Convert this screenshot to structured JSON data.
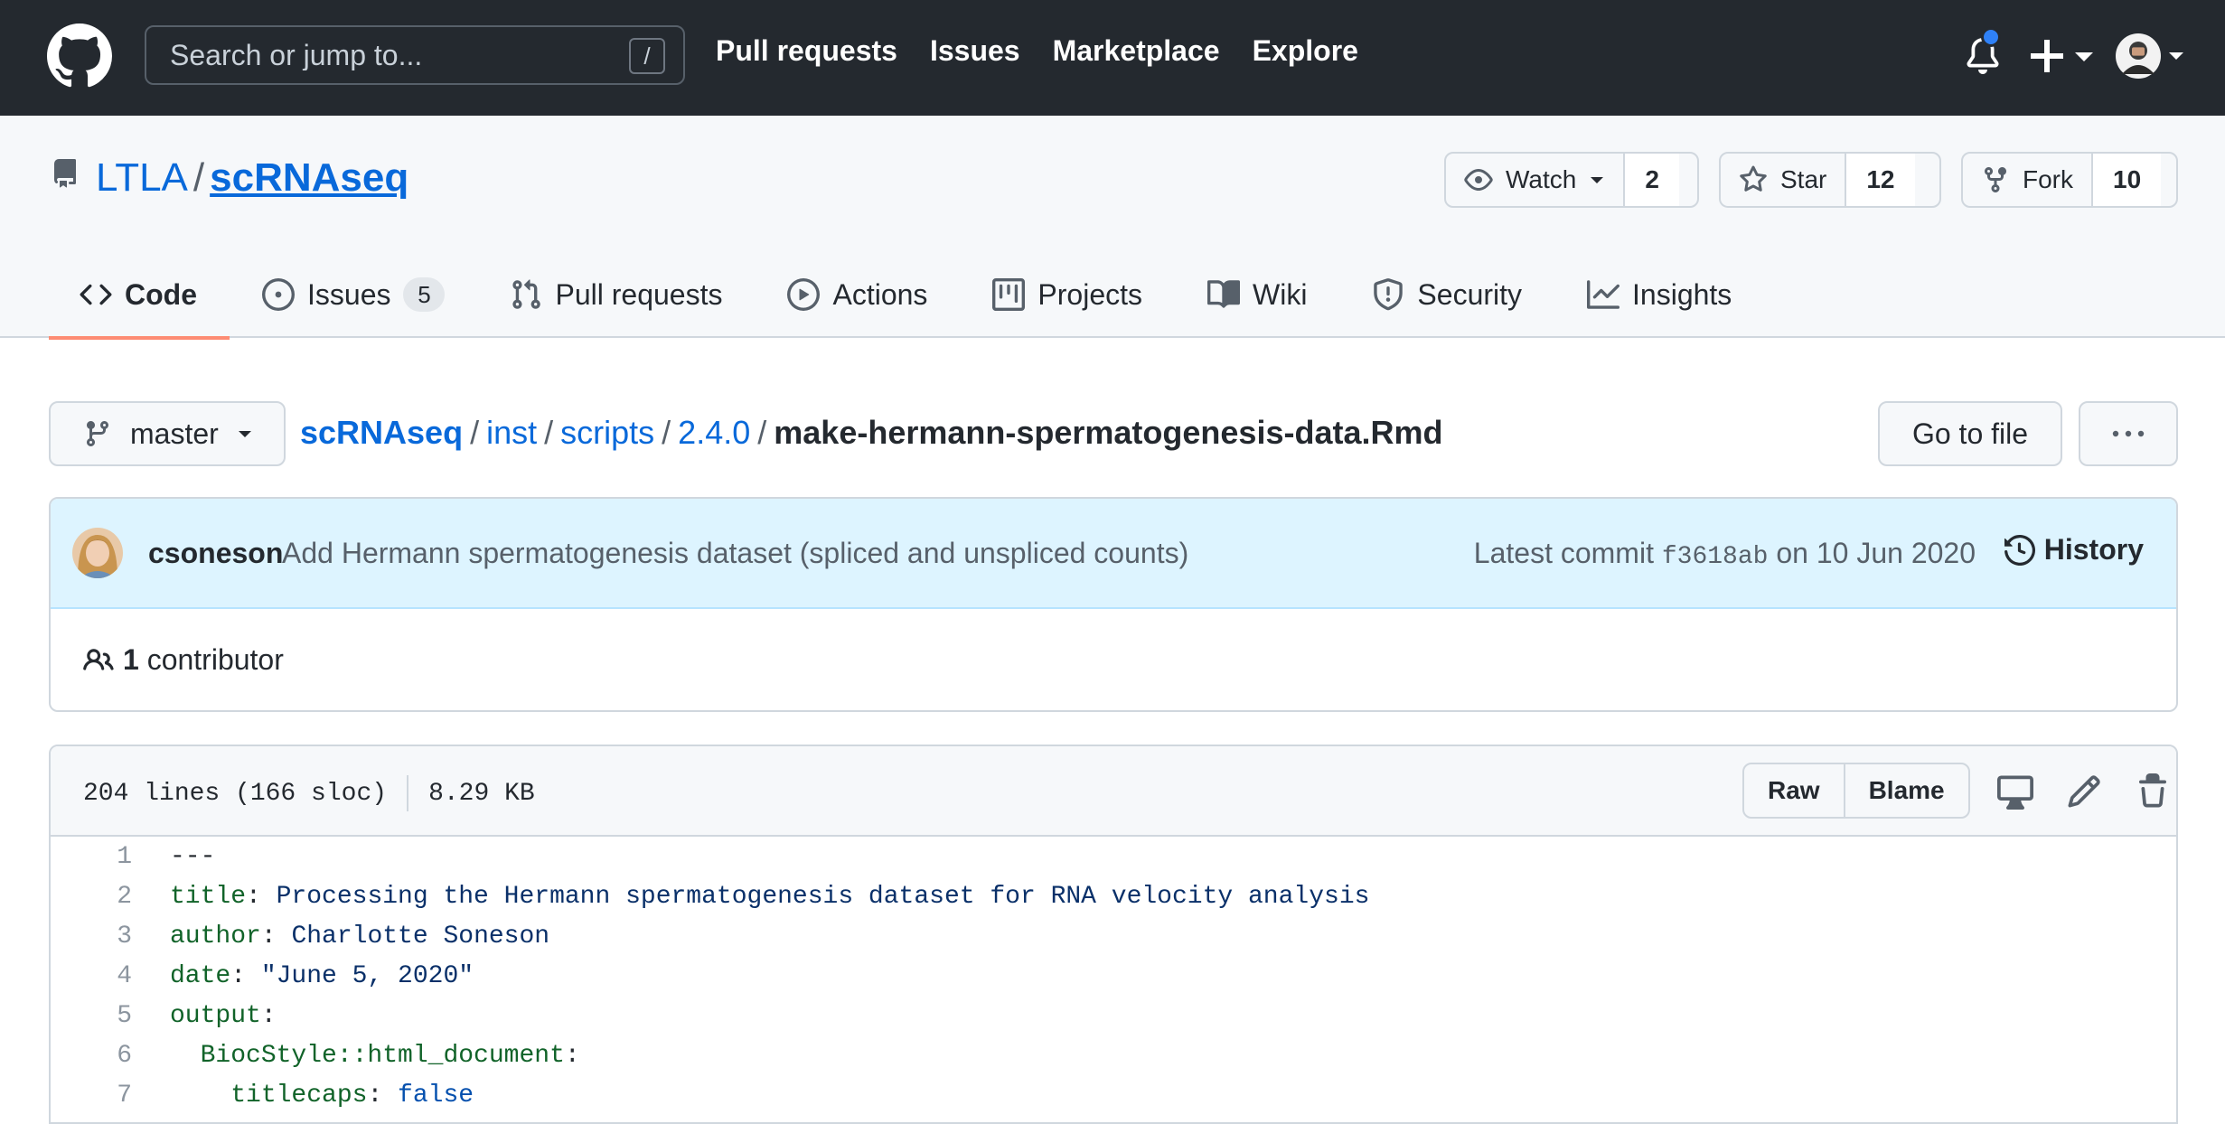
{
  "header": {
    "search_placeholder": "Search or jump to...",
    "search_key": "/",
    "nav": [
      "Pull requests",
      "Issues",
      "Marketplace",
      "Explore"
    ]
  },
  "repo": {
    "owner": "LTLA",
    "separator": "/",
    "name": "scRNAseq",
    "watch": {
      "label": "Watch",
      "count": "2"
    },
    "star": {
      "label": "Star",
      "count": "12"
    },
    "fork": {
      "label": "Fork",
      "count": "10"
    },
    "tabs": {
      "code": "Code",
      "issues": "Issues",
      "issues_count": "5",
      "pulls": "Pull requests",
      "actions": "Actions",
      "projects": "Projects",
      "wiki": "Wiki",
      "security": "Security",
      "insights": "Insights"
    }
  },
  "file_nav": {
    "branch": "master",
    "path": [
      "scRNAseq",
      "inst",
      "scripts",
      "2.4.0"
    ],
    "filename": "make-hermann-spermatogenesis-data.Rmd",
    "goto_label": "Go to file",
    "more_label": "···"
  },
  "commit": {
    "author": "csoneson",
    "message": "Add Hermann spermatogenesis dataset (spliced and unspliced counts)",
    "meta_prefix": "Latest commit",
    "sha": "f3618ab",
    "meta_suffix": "on 10 Jun 2020",
    "history_label": "History",
    "contributor_count": "1",
    "contributor_label": "contributor"
  },
  "file": {
    "lines_info": "204 lines (166 sloc)",
    "size": "8.29 KB",
    "raw_label": "Raw",
    "blame_label": "Blame",
    "code": [
      {
        "n": "1",
        "key": "",
        "value": "---"
      },
      {
        "n": "2",
        "key": "title",
        "value": "Processing the Hermann spermatogenesis dataset for RNA velocity analysis"
      },
      {
        "n": "3",
        "key": "author",
        "value": "Charlotte Soneson"
      },
      {
        "n": "4",
        "key": "date",
        "value": "\"June 5, 2020\""
      },
      {
        "n": "5",
        "key": "output",
        "value": ""
      },
      {
        "n": "6",
        "key": "  BiocStyle::html_document",
        "value": ""
      },
      {
        "n": "7",
        "key": "    titlecaps",
        "value": "false"
      }
    ]
  },
  "colors": {
    "header_bg": "#24292f",
    "link": "#0969da",
    "selected_tab_underline": "#fd8c73",
    "commit_bg": "#ddf4ff",
    "notification_dot": "#2f81f7"
  },
  "icons": [
    "github-logo",
    "bell-icon",
    "plus-icon",
    "repo-icon",
    "eye-icon",
    "star-icon",
    "fork-icon",
    "code-icon",
    "issue-icon",
    "pull-request-icon",
    "play-icon",
    "project-icon",
    "book-icon",
    "shield-icon",
    "graph-icon",
    "branch-icon",
    "history-icon",
    "people-icon",
    "desktop-icon",
    "pencil-icon",
    "trash-icon"
  ]
}
